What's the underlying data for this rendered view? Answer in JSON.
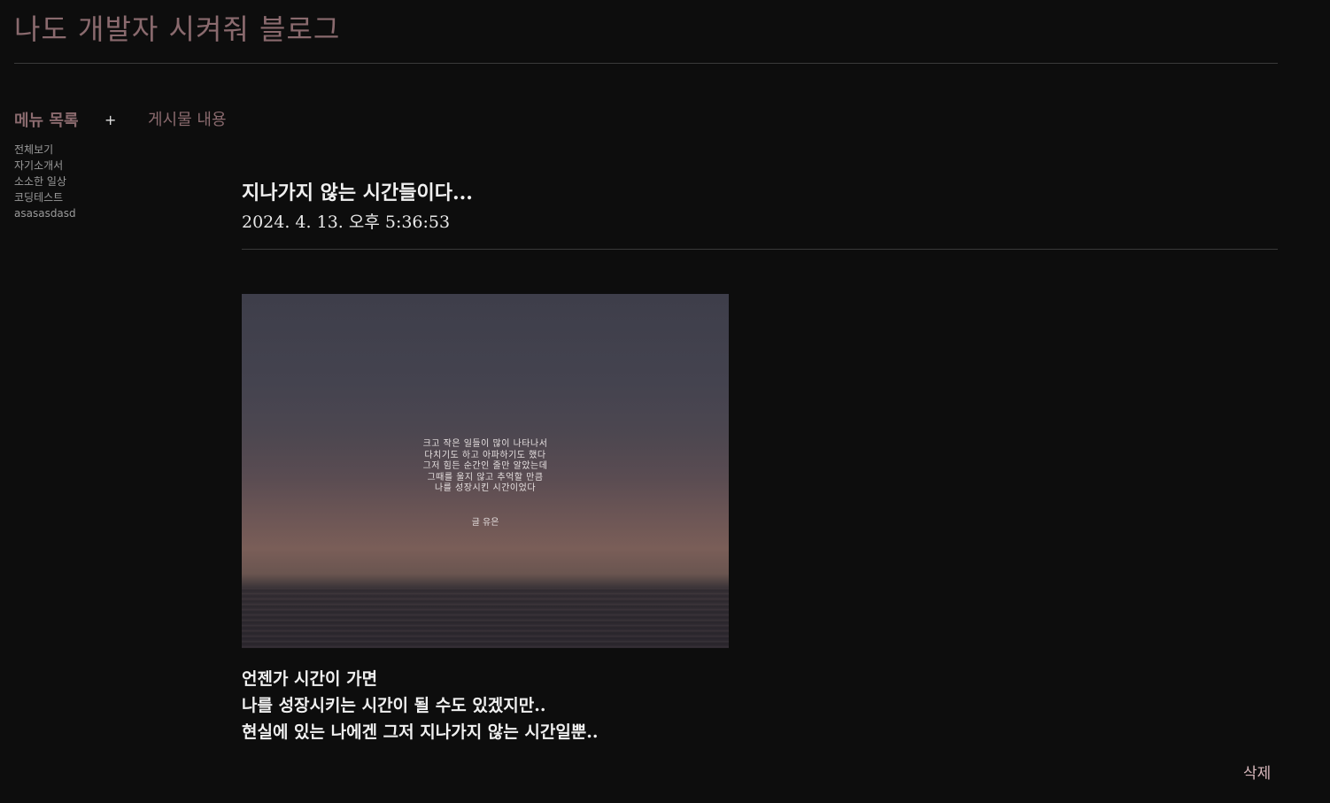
{
  "header": {
    "blog_title": "나도 개발자 시켜줘 블로그"
  },
  "sidebar": {
    "heading": "메뉴 목록",
    "add_label": "+",
    "items": [
      {
        "label": "전체보기"
      },
      {
        "label": "자기소개서"
      },
      {
        "label": "소소한 일상"
      },
      {
        "label": "코딩테스트"
      },
      {
        "label": "asasasdasd"
      }
    ]
  },
  "content": {
    "heading": "게시물 내용"
  },
  "post": {
    "title": "지나가지 않는 시간들이다...",
    "date": "2024. 4. 13. 오후 5:36:53",
    "image": {
      "poem_lines": [
        "크고 작은 일들이 많이 나타나서",
        "다치기도 하고 아파하기도 했다",
        "그저 힘든 순간인 줄만 알았는데",
        "그때를 울지 않고 추억할 만큼",
        "나를 성장시킨 시간이었다"
      ],
      "author": "글 유은"
    },
    "body_lines": [
      "언젠가 시간이 가면",
      "나를 성장시키는 시간이 될 수도 있겠지만..",
      "현실에 있는 나에겐 그저 지나가지 않는 시간일뿐.."
    ],
    "delete_label": "삭제"
  }
}
